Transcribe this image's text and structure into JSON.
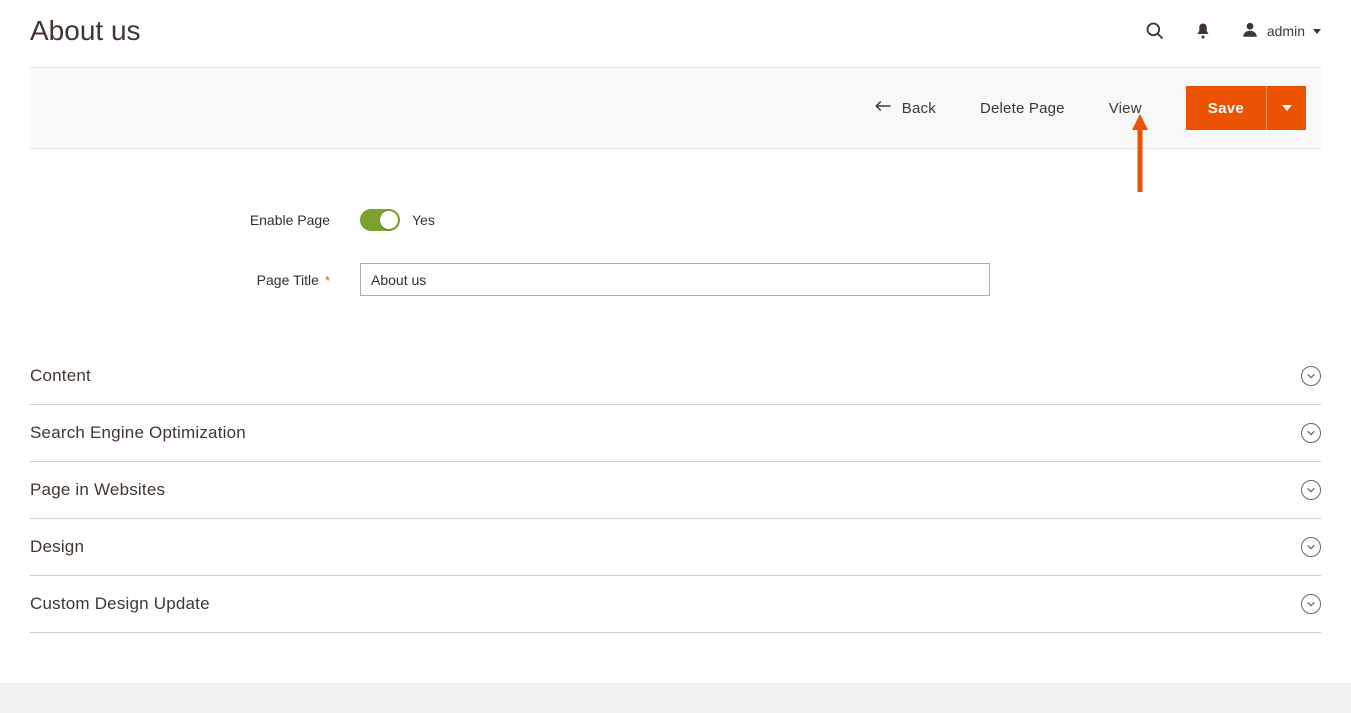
{
  "header": {
    "title": "About us",
    "user_label": "admin"
  },
  "actions": {
    "back": "Back",
    "delete": "Delete Page",
    "view": "View",
    "save": "Save"
  },
  "form": {
    "enable_label": "Enable Page",
    "enable_value": "Yes",
    "title_label": "Page Title",
    "title_value": "About us"
  },
  "sections": [
    {
      "title": "Content"
    },
    {
      "title": "Search Engine Optimization"
    },
    {
      "title": "Page in Websites"
    },
    {
      "title": "Design"
    },
    {
      "title": "Custom Design Update"
    }
  ]
}
